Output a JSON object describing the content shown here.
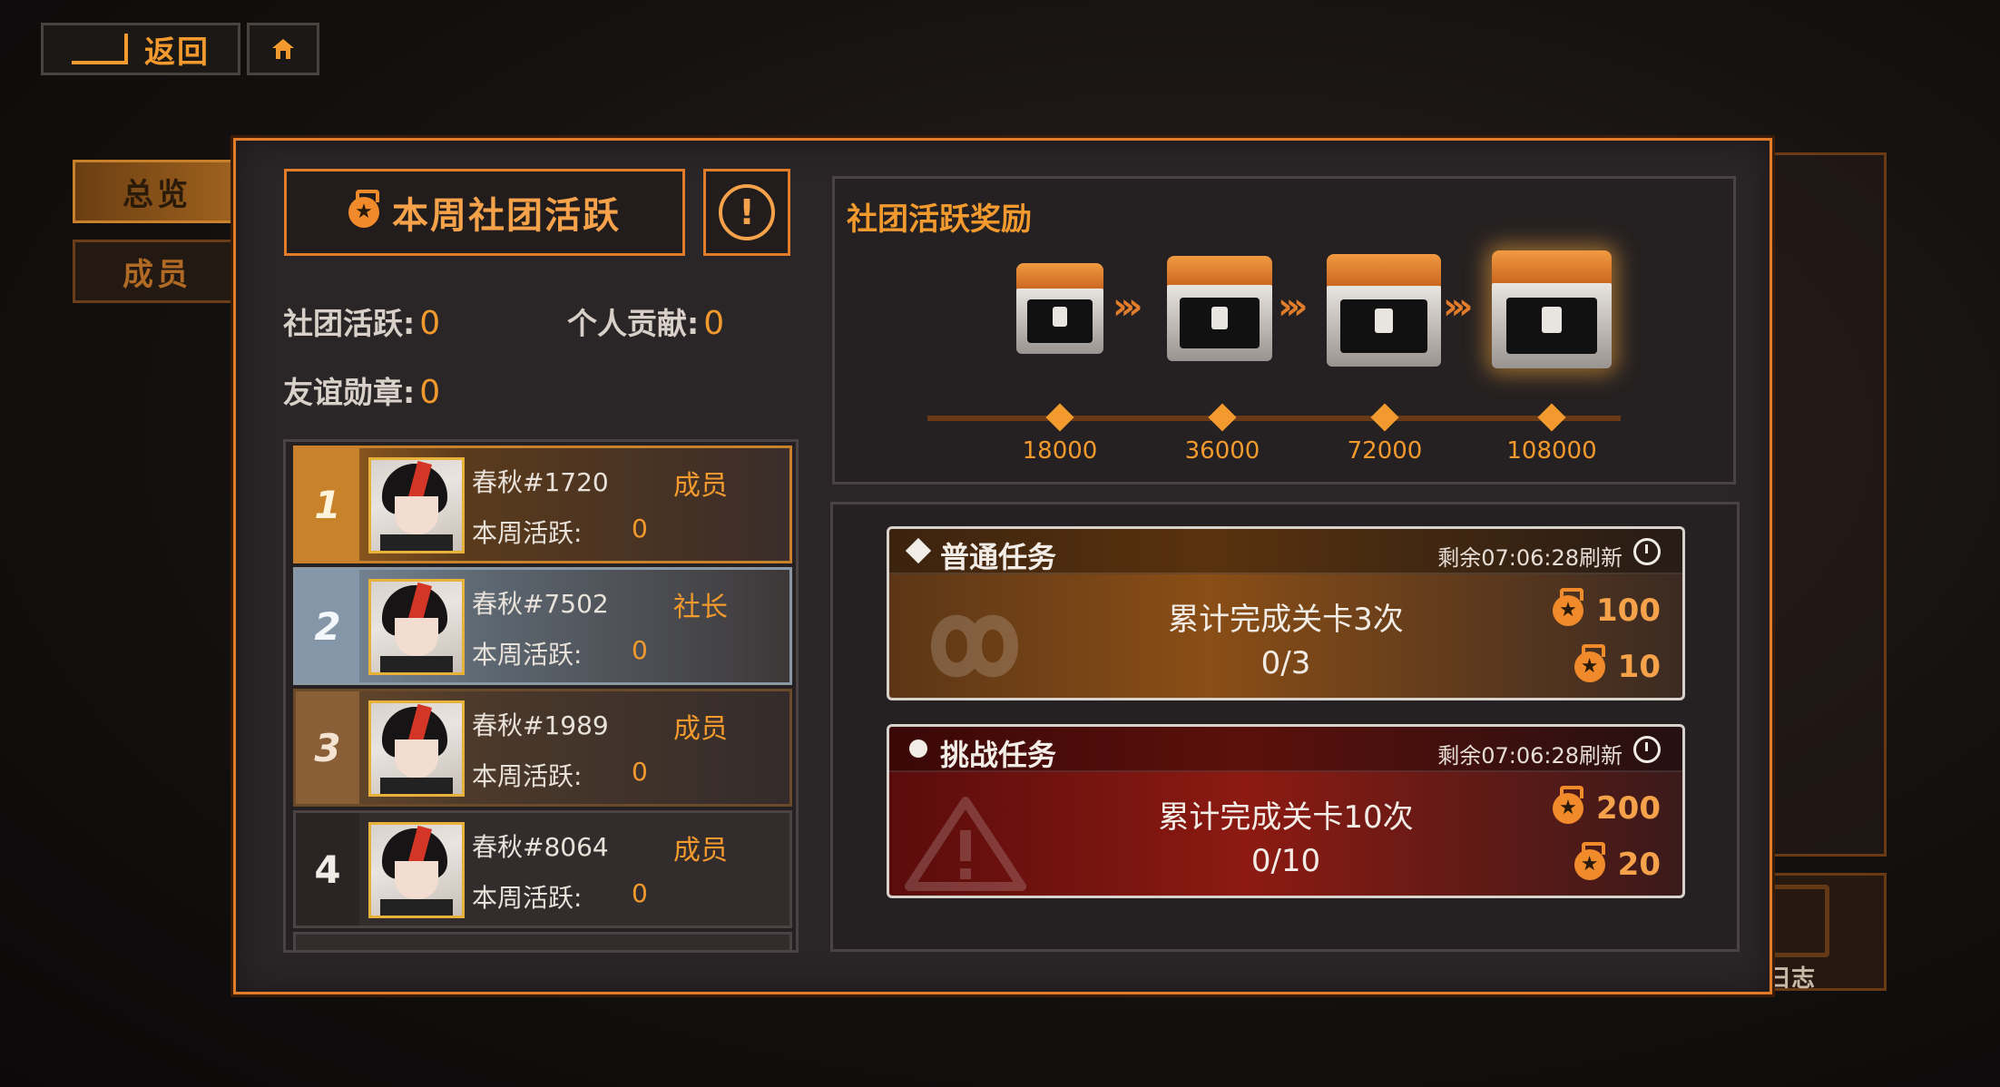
{
  "nav": {
    "back_label": "返回"
  },
  "tabs": {
    "overview": "总览",
    "members": "成员"
  },
  "side": {
    "log_label": "日志"
  },
  "header": {
    "title": "本周社团活跃",
    "info_icon": "!"
  },
  "stats": {
    "club_activity_label": "社团活跃:",
    "club_activity_value": "0",
    "personal_label": "个人贡献:",
    "personal_value": "0",
    "friendship_label": "友谊勋章:",
    "friendship_value": "0"
  },
  "ranking": [
    {
      "rank": "1",
      "name": "春秋#1720",
      "role": "成员",
      "activity_label": "本周活跃:",
      "activity": "0"
    },
    {
      "rank": "2",
      "name": "春秋#7502",
      "role": "社长",
      "activity_label": "本周活跃:",
      "activity": "0"
    },
    {
      "rank": "3",
      "name": "春秋#1989",
      "role": "成员",
      "activity_label": "本周活跃:",
      "activity": "0"
    },
    {
      "rank": "4",
      "name": "春秋#8064",
      "role": "成员",
      "activity_label": "本周活跃:",
      "activity": "0"
    }
  ],
  "rewards": {
    "title": "社团活跃奖励",
    "thresholds": [
      "18000",
      "36000",
      "72000",
      "108000"
    ]
  },
  "tasks": {
    "normal": {
      "name": "普通任务",
      "refresh": "剩余07:06:28刷新",
      "desc": "累计完成关卡3次",
      "progress": "0/3",
      "reward_a": "100",
      "reward_b": "10"
    },
    "challenge": {
      "name": "挑战任务",
      "refresh": "剩余07:06:28刷新",
      "desc": "累计完成关卡10次",
      "progress": "0/10",
      "reward_a": "200",
      "reward_b": "20"
    }
  },
  "colors": {
    "accent": "#e07c2a",
    "text_orange": "#f29a2e",
    "panel": "#2a2526"
  }
}
